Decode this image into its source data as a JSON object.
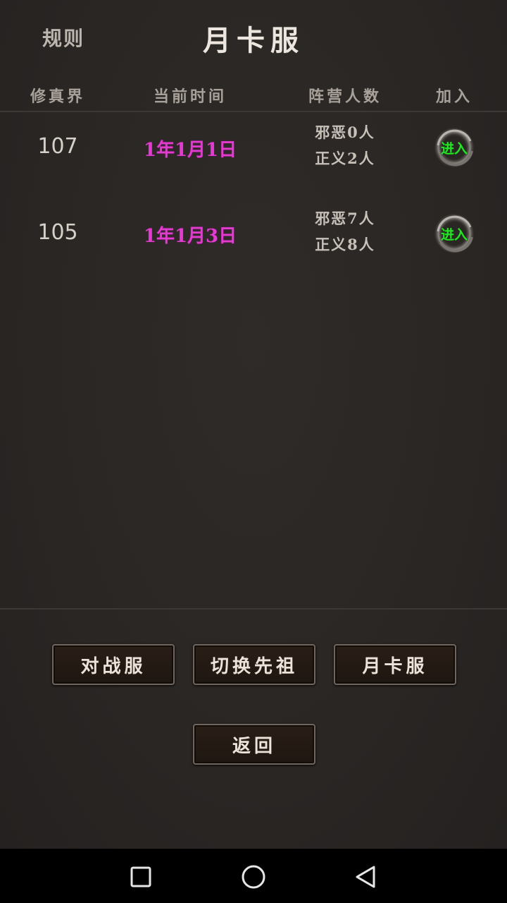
{
  "header": {
    "rules_label": "规则",
    "title": "月卡服"
  },
  "table": {
    "columns": [
      "修真界",
      "当前时间",
      "阵营人数",
      "加入"
    ],
    "rows": [
      {
        "realm": "107",
        "time": "1年1月1日",
        "evil": "邪恶0人",
        "righteous": "正义2人",
        "join_label": "进入"
      },
      {
        "realm": "105",
        "time": "1年1月3日",
        "evil": "邪恶7人",
        "righteous": "正义8人",
        "join_label": "进入"
      }
    ]
  },
  "buttons": {
    "pvp_server": "对战服",
    "switch_ancestor": "切换先祖",
    "month_card_server": "月卡服",
    "back": "返回"
  },
  "colors": {
    "background": "#2b2725",
    "time_text": "#e23ccf",
    "join_text": "#27e227"
  },
  "system_nav": {
    "icons": [
      "recents-icon",
      "home-icon",
      "back-icon"
    ]
  }
}
